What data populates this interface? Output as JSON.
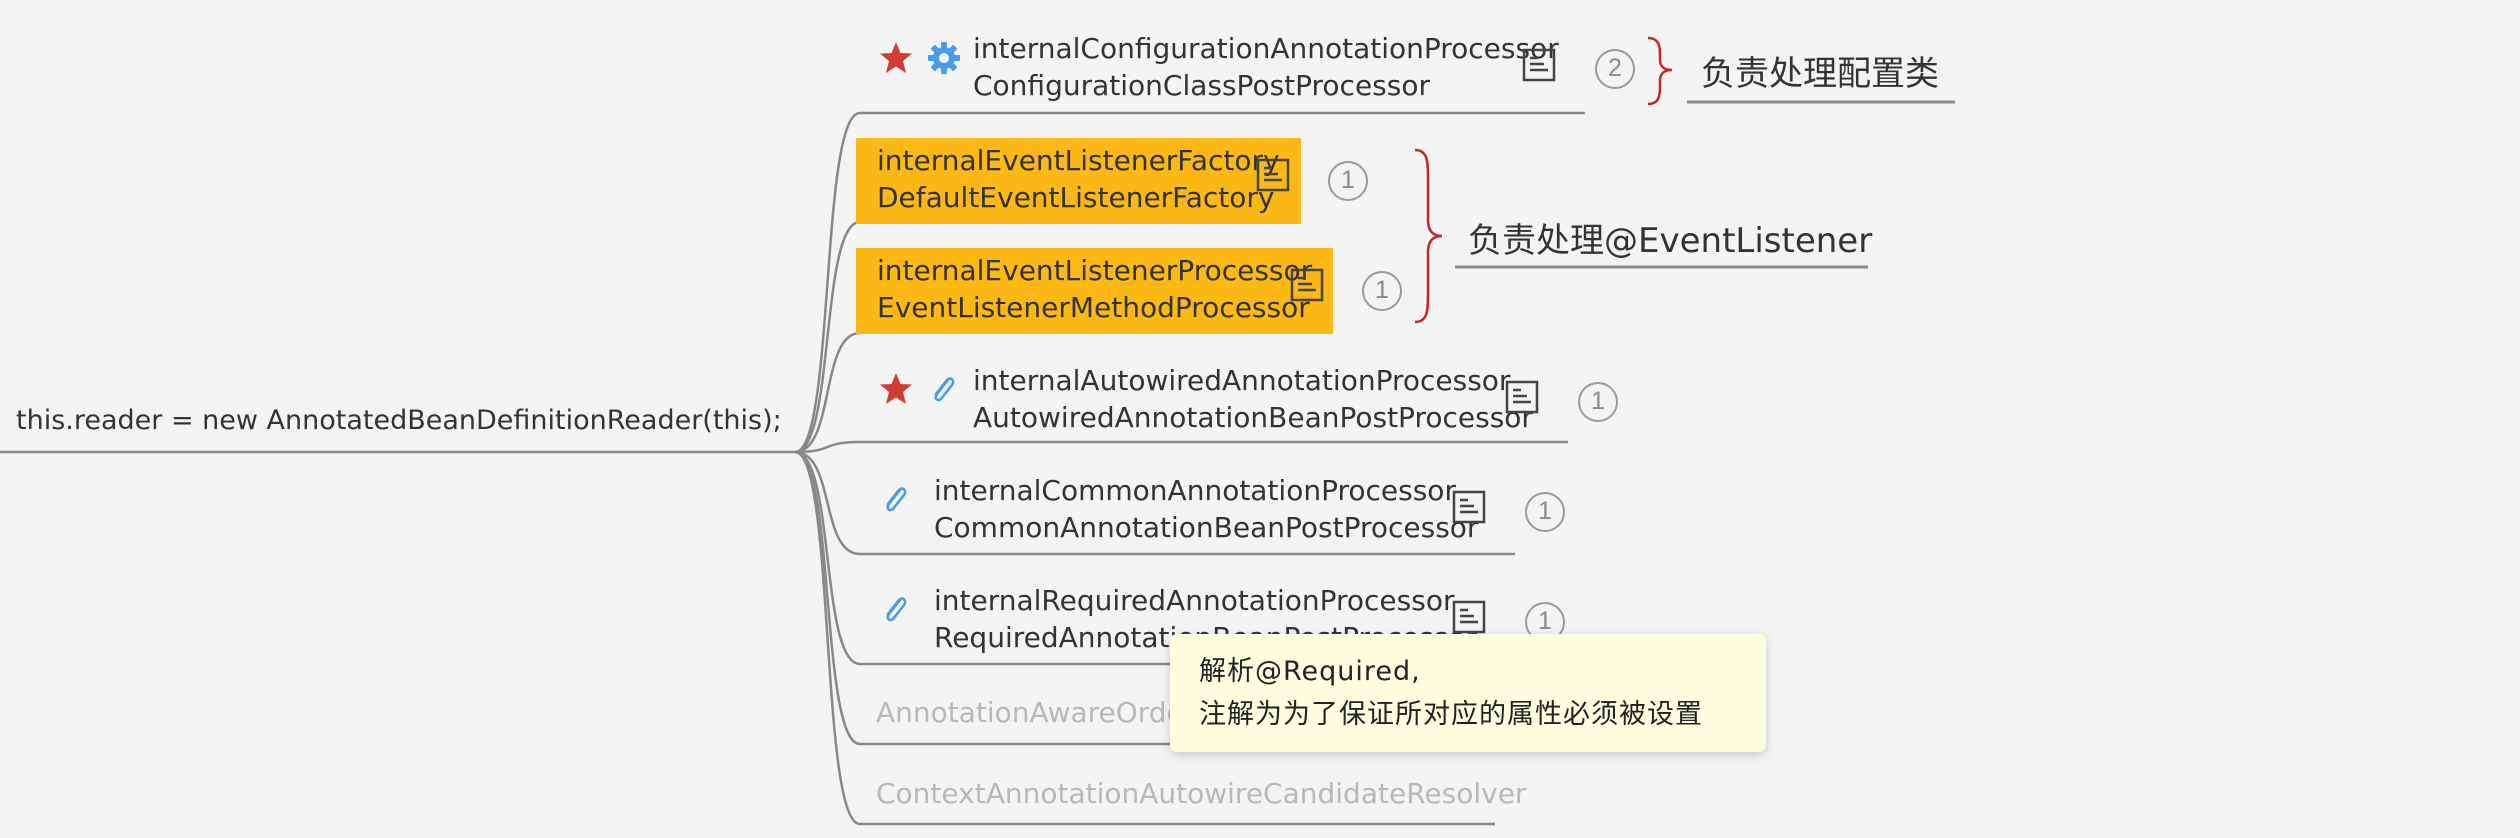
{
  "root": {
    "text": "this.reader = new AnnotatedBeanDefinitionReader(this);"
  },
  "nodes": [
    {
      "line1": "internalConfigurationAnnotationProcessor",
      "line2": "ConfigurationClassPostProcessor",
      "badge": "2",
      "starred": true,
      "icon": "gear-icon",
      "highlighted": false
    },
    {
      "line1": "internalEventListenerFactory",
      "line2": "DefaultEventListenerFactory",
      "badge": "1",
      "highlighted": true,
      "highlight_color": "#fcb814"
    },
    {
      "line1": "internalEventListenerProcessor",
      "line2": "EventListenerMethodProcessor",
      "badge": "1",
      "highlighted": true,
      "highlight_color": "#fcb814"
    },
    {
      "line1": "internalAutowiredAnnotationProcessor",
      "line2": "AutowiredAnnotationBeanPostProcessor",
      "badge": "1",
      "starred": true,
      "icon": "paperclip-icon",
      "highlighted": false
    },
    {
      "line1": "internalCommonAnnotationProcessor",
      "line2": "CommonAnnotationBeanPostProcessor",
      "badge": "1",
      "icon": "paperclip-icon",
      "highlighted": false
    },
    {
      "line1": "internalRequiredAnnotationProcessor",
      "line2": "RequiredAnnotationBeanPostProcessor",
      "badge": "1",
      "icon": "paperclip-icon",
      "highlighted": false
    },
    {
      "line1": "AnnotationAwareOrderComparator",
      "faded": true
    },
    {
      "line1": "ContextAnnotationAutowireCandidateResolver",
      "faded": true
    }
  ],
  "brace_labels": [
    {
      "text": "负责处理配置类"
    },
    {
      "text": "负责处理@EventListener"
    }
  ],
  "tooltip": {
    "line1": "解析@Required,",
    "line2": "注解为为了保证所对应的属性必须被设置"
  },
  "colors": {
    "background": "#f4f4f4",
    "highlight": "#fcb814",
    "star": "#d43b33",
    "gear": "#4a9be8",
    "paperclip": "#4a9be8",
    "brace": "#c62828",
    "connector": "#888888",
    "tooltip_bg": "#fdfde0"
  }
}
